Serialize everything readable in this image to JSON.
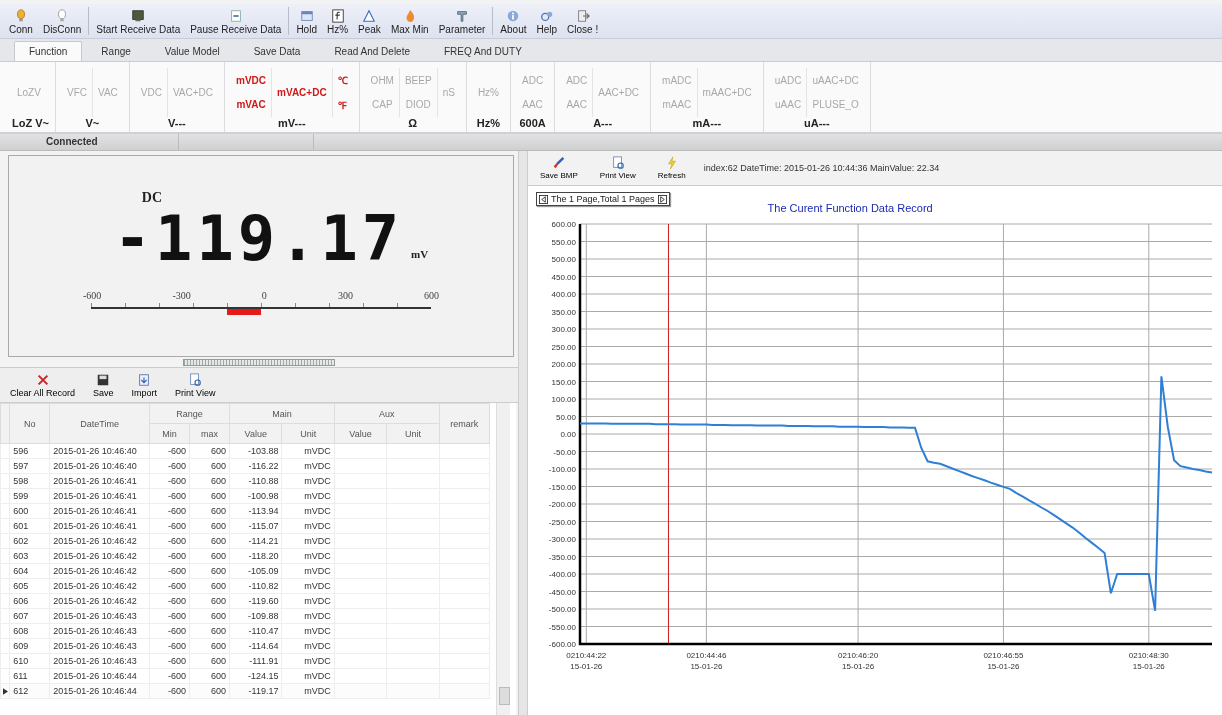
{
  "toolbar": [
    [
      {
        "label": "Conn",
        "kind": "bulb"
      },
      {
        "label": "DisConn",
        "kind": "bulb-off"
      }
    ],
    [
      {
        "label": "Start Receive Data",
        "kind": "monitor"
      },
      {
        "label": "Pause Receive Data",
        "kind": "page"
      }
    ],
    [
      {
        "label": "Hold",
        "kind": "window"
      },
      {
        "label": "Hz%",
        "kind": "function"
      },
      {
        "label": "Peak",
        "kind": "triangle"
      },
      {
        "label": "Max Min",
        "kind": "flame"
      },
      {
        "label": "Parameter",
        "kind": "tool"
      }
    ],
    [
      {
        "label": "About",
        "kind": "info"
      },
      {
        "label": "Help",
        "kind": "help"
      },
      {
        "label": "Close !",
        "kind": "exit"
      }
    ]
  ],
  "tabs": [
    {
      "label": "Function",
      "selected": true
    },
    {
      "label": "Range",
      "selected": false
    },
    {
      "label": "Value Model",
      "selected": false
    },
    {
      "label": "Save Data",
      "selected": false
    },
    {
      "label": "Read And Delete",
      "selected": false
    },
    {
      "label": "FREQ And DUTY",
      "selected": false
    }
  ],
  "ribbon": [
    {
      "label": "LoZ V~",
      "columns": [
        [
          {
            "text": "LoZV",
            "disabled": true
          }
        ]
      ]
    },
    {
      "label": "V~",
      "columns": [
        [
          {
            "text": "VFC",
            "disabled": true
          }
        ],
        [
          {
            "text": "VAC",
            "disabled": true
          }
        ]
      ]
    },
    {
      "label": "V---",
      "columns": [
        [
          {
            "text": "VDC",
            "disabled": true
          }
        ],
        [
          {
            "text": "VAC+DC",
            "disabled": true
          }
        ]
      ]
    },
    {
      "label": "mV---",
      "columns": [
        [
          {
            "text": "mVDC",
            "disabled": false
          },
          {
            "text": "mVAC",
            "disabled": false
          }
        ],
        [
          {
            "text": "mVAC+DC",
            "disabled": false
          }
        ],
        [
          {
            "text": "℃",
            "disabled": false
          },
          {
            "text": "℉",
            "disabled": false
          }
        ]
      ]
    },
    {
      "label": "Ω",
      "columns": [
        [
          {
            "text": "OHM",
            "disabled": true
          },
          {
            "text": "CAP",
            "disabled": true
          }
        ],
        [
          {
            "text": "BEEP",
            "disabled": true
          },
          {
            "text": "DIOD",
            "disabled": true
          }
        ],
        [
          {
            "text": "nS",
            "disabled": true
          }
        ]
      ]
    },
    {
      "label": "Hz%",
      "columns": [
        [
          {
            "text": "Hz%",
            "disabled": true
          }
        ]
      ]
    },
    {
      "label": "600A",
      "columns": [
        [
          {
            "text": "ADC",
            "disabled": true
          },
          {
            "text": "AAC",
            "disabled": true
          }
        ]
      ]
    },
    {
      "label": "A---",
      "columns": [
        [
          {
            "text": "ADC",
            "disabled": true
          },
          {
            "text": "AAC",
            "disabled": true
          }
        ],
        [
          {
            "text": "AAC+DC",
            "disabled": true
          }
        ]
      ]
    },
    {
      "label": "mA---",
      "columns": [
        [
          {
            "text": "mADC",
            "disabled": true
          },
          {
            "text": "mAAC",
            "disabled": true
          }
        ],
        [
          {
            "text": "mAAC+DC",
            "disabled": true
          }
        ]
      ]
    },
    {
      "label": "uA---",
      "columns": [
        [
          {
            "text": "uADC",
            "disabled": true
          },
          {
            "text": "uAAC",
            "disabled": true
          }
        ],
        [
          {
            "text": "uAAC+DC",
            "disabled": true
          },
          {
            "text": "PLUSE_O",
            "disabled": true
          }
        ]
      ]
    }
  ],
  "status_bar": {
    "text": "Connected"
  },
  "display": {
    "mode": "DC",
    "value": "-119.17",
    "unit": "mV",
    "scale_labels": [
      "-600",
      "-300",
      "0",
      "300",
      "600"
    ]
  },
  "record_toolbar": [
    {
      "label": "Clear All Record",
      "kind": "cross"
    },
    {
      "label": "Save",
      "kind": "disk"
    },
    {
      "label": "Import",
      "kind": "import"
    },
    {
      "label": "Print View",
      "kind": "preview"
    }
  ],
  "table": {
    "columns": {
      "no": "No",
      "datetime": "DateTime",
      "range": "Range",
      "range_min": "Min",
      "range_max": "max",
      "main": "Main",
      "main_value": "Value",
      "main_unit": "Unit",
      "aux": "Aux",
      "aux_value": "Value",
      "aux_unit": "Unit",
      "remark": "remark"
    },
    "rows": [
      {
        "no": "596",
        "datetime": "2015-01-26 10:46:40",
        "min": "-600",
        "max": "600",
        "value": "-103.88",
        "unit": "mVDC",
        "selected": false
      },
      {
        "no": "597",
        "datetime": "2015-01-26 10:46:40",
        "min": "-600",
        "max": "600",
        "value": "-116.22",
        "unit": "mVDC",
        "selected": false
      },
      {
        "no": "598",
        "datetime": "2015-01-26 10:46:41",
        "min": "-600",
        "max": "600",
        "value": "-110.88",
        "unit": "mVDC",
        "selected": false
      },
      {
        "no": "599",
        "datetime": "2015-01-26 10:46:41",
        "min": "-600",
        "max": "600",
        "value": "-100.98",
        "unit": "mVDC",
        "selected": false
      },
      {
        "no": "600",
        "datetime": "2015-01-26 10:46:41",
        "min": "-600",
        "max": "600",
        "value": "-113.94",
        "unit": "mVDC",
        "selected": false
      },
      {
        "no": "601",
        "datetime": "2015-01-26 10:46:41",
        "min": "-600",
        "max": "600",
        "value": "-115.07",
        "unit": "mVDC",
        "selected": false
      },
      {
        "no": "602",
        "datetime": "2015-01-26 10:46:42",
        "min": "-600",
        "max": "600",
        "value": "-114.21",
        "unit": "mVDC",
        "selected": false
      },
      {
        "no": "603",
        "datetime": "2015-01-26 10:46:42",
        "min": "-600",
        "max": "600",
        "value": "-118.20",
        "unit": "mVDC",
        "selected": false
      },
      {
        "no": "604",
        "datetime": "2015-01-26 10:46:42",
        "min": "-600",
        "max": "600",
        "value": "-105.09",
        "unit": "mVDC",
        "selected": false
      },
      {
        "no": "605",
        "datetime": "2015-01-26 10:46:42",
        "min": "-600",
        "max": "600",
        "value": "-110.82",
        "unit": "mVDC",
        "selected": false
      },
      {
        "no": "606",
        "datetime": "2015-01-26 10:46:42",
        "min": "-600",
        "max": "600",
        "value": "-119.60",
        "unit": "mVDC",
        "selected": false
      },
      {
        "no": "607",
        "datetime": "2015-01-26 10:46:43",
        "min": "-600",
        "max": "600",
        "value": "-109.88",
        "unit": "mVDC",
        "selected": false
      },
      {
        "no": "608",
        "datetime": "2015-01-26 10:46:43",
        "min": "-600",
        "max": "600",
        "value": "-110.47",
        "unit": "mVDC",
        "selected": false
      },
      {
        "no": "609",
        "datetime": "2015-01-26 10:46:43",
        "min": "-600",
        "max": "600",
        "value": "-114.64",
        "unit": "mVDC",
        "selected": false
      },
      {
        "no": "610",
        "datetime": "2015-01-26 10:46:43",
        "min": "-600",
        "max": "600",
        "value": "-111.91",
        "unit": "mVDC",
        "selected": false
      },
      {
        "no": "611",
        "datetime": "2015-01-26 10:46:44",
        "min": "-600",
        "max": "600",
        "value": "-124.15",
        "unit": "mVDC",
        "selected": false
      },
      {
        "no": "612",
        "datetime": "2015-01-26 10:46:44",
        "min": "-600",
        "max": "600",
        "value": "-119.17",
        "unit": "mVDC",
        "selected": true
      }
    ]
  },
  "chart_panel": {
    "toolbar": [
      {
        "label": "Save BMP",
        "kind": "brush"
      },
      {
        "label": "Print View",
        "kind": "preview"
      },
      {
        "label": "Refresh",
        "kind": "bolt"
      }
    ],
    "info": "index:62 DateTime: 2015-01-26 10:44:36  MainValue: 22.34",
    "pager": "The 1 Page,Total 1 Pages",
    "chart_data": {
      "type": "line",
      "title": "The Curent Function Data Record",
      "categories": [
        null,
        "0210:44:22 15-01-26",
        null,
        null,
        null,
        null,
        null,
        null,
        null,
        null,
        null,
        null,
        null,
        null,
        null,
        null,
        null,
        null,
        null,
        null,
        "0210:44:46 15-01-26",
        null,
        null,
        null,
        null,
        null,
        null,
        null,
        null,
        null,
        null,
        null,
        null,
        null,
        null,
        null,
        null,
        null,
        null,
        null,
        null,
        null,
        null,
        null,
        "0210:46:20 15-01-26",
        null,
        null,
        null,
        null,
        null,
        null,
        null,
        null,
        null,
        null,
        null,
        null,
        null,
        null,
        null,
        null,
        null,
        null,
        null,
        null,
        null,
        null,
        "0210:46:55 15-01-26",
        null,
        null,
        null,
        null,
        null,
        null,
        null,
        null,
        null,
        null,
        null,
        null,
        null,
        null,
        null,
        null,
        null,
        null,
        null,
        null,
        null,
        null,
        "0210:48:30 15-01-26",
        null,
        null,
        null,
        null,
        null,
        null,
        null,
        null,
        null,
        null
      ],
      "series": [
        {
          "color": "#2f7fd6",
          "values": [
            30,
            30,
            30,
            30,
            30,
            29,
            29,
            29,
            29,
            29,
            29,
            29,
            28,
            28,
            28,
            28,
            27,
            27,
            27,
            27,
            27,
            26,
            26,
            26,
            25,
            25,
            25,
            25,
            24,
            24,
            24,
            24,
            24,
            23,
            23,
            23,
            23,
            22,
            22,
            22,
            22,
            21,
            21,
            21,
            21,
            20,
            20,
            20,
            20,
            19,
            19,
            19,
            18,
            18,
            -40,
            -78,
            -82,
            -85,
            -92,
            -99,
            -106,
            -113,
            -120,
            -126,
            -132,
            -139,
            -145,
            -151,
            -157,
            -168,
            -178,
            -189,
            -199,
            -210,
            -220,
            -232,
            -244,
            -256,
            -268,
            -282,
            -297,
            -311,
            -325,
            -340,
            -455,
            -400,
            -400,
            -400,
            -400,
            -400,
            -400,
            -505,
            165,
            20,
            -75,
            -92,
            -96,
            -100,
            -103,
            -107,
            -110
          ]
        }
      ],
      "ylim": [
        -600,
        600
      ],
      "grid": true,
      "yticks": [
        {
          "value": 600,
          "label": "600.00"
        },
        {
          "value": 550,
          "label": "550.00"
        },
        {
          "value": 500,
          "label": "500.00"
        },
        {
          "value": 450,
          "label": "450.00"
        },
        {
          "value": 400,
          "label": "400.00"
        },
        {
          "value": 350,
          "label": "350.00"
        },
        {
          "value": 300,
          "label": "300.00"
        },
        {
          "value": 250,
          "label": "250.00"
        },
        {
          "value": 200,
          "label": "200.00"
        },
        {
          "value": 150,
          "label": "150.00"
        },
        {
          "value": 100,
          "label": "100.00"
        },
        {
          "value": 50,
          "label": "50.00"
        },
        {
          "value": 0,
          "label": "0.00"
        },
        {
          "value": -50,
          "label": "-50.00"
        },
        {
          "value": -100,
          "label": "-100.00"
        },
        {
          "value": -150,
          "label": "-150.00"
        },
        {
          "value": -200,
          "label": "-200.00"
        },
        {
          "value": -250,
          "label": "-250.00"
        },
        {
          "value": -300,
          "label": "-300.00"
        },
        {
          "value": -350,
          "label": "-350.00"
        },
        {
          "value": -400,
          "label": "-400.00"
        },
        {
          "value": -450,
          "label": "-450.00"
        },
        {
          "value": -500,
          "label": "-500.00"
        },
        {
          "value": -550,
          "label": "-550.00"
        },
        {
          "value": -600,
          "label": "-600.00"
        }
      ]
    }
  }
}
